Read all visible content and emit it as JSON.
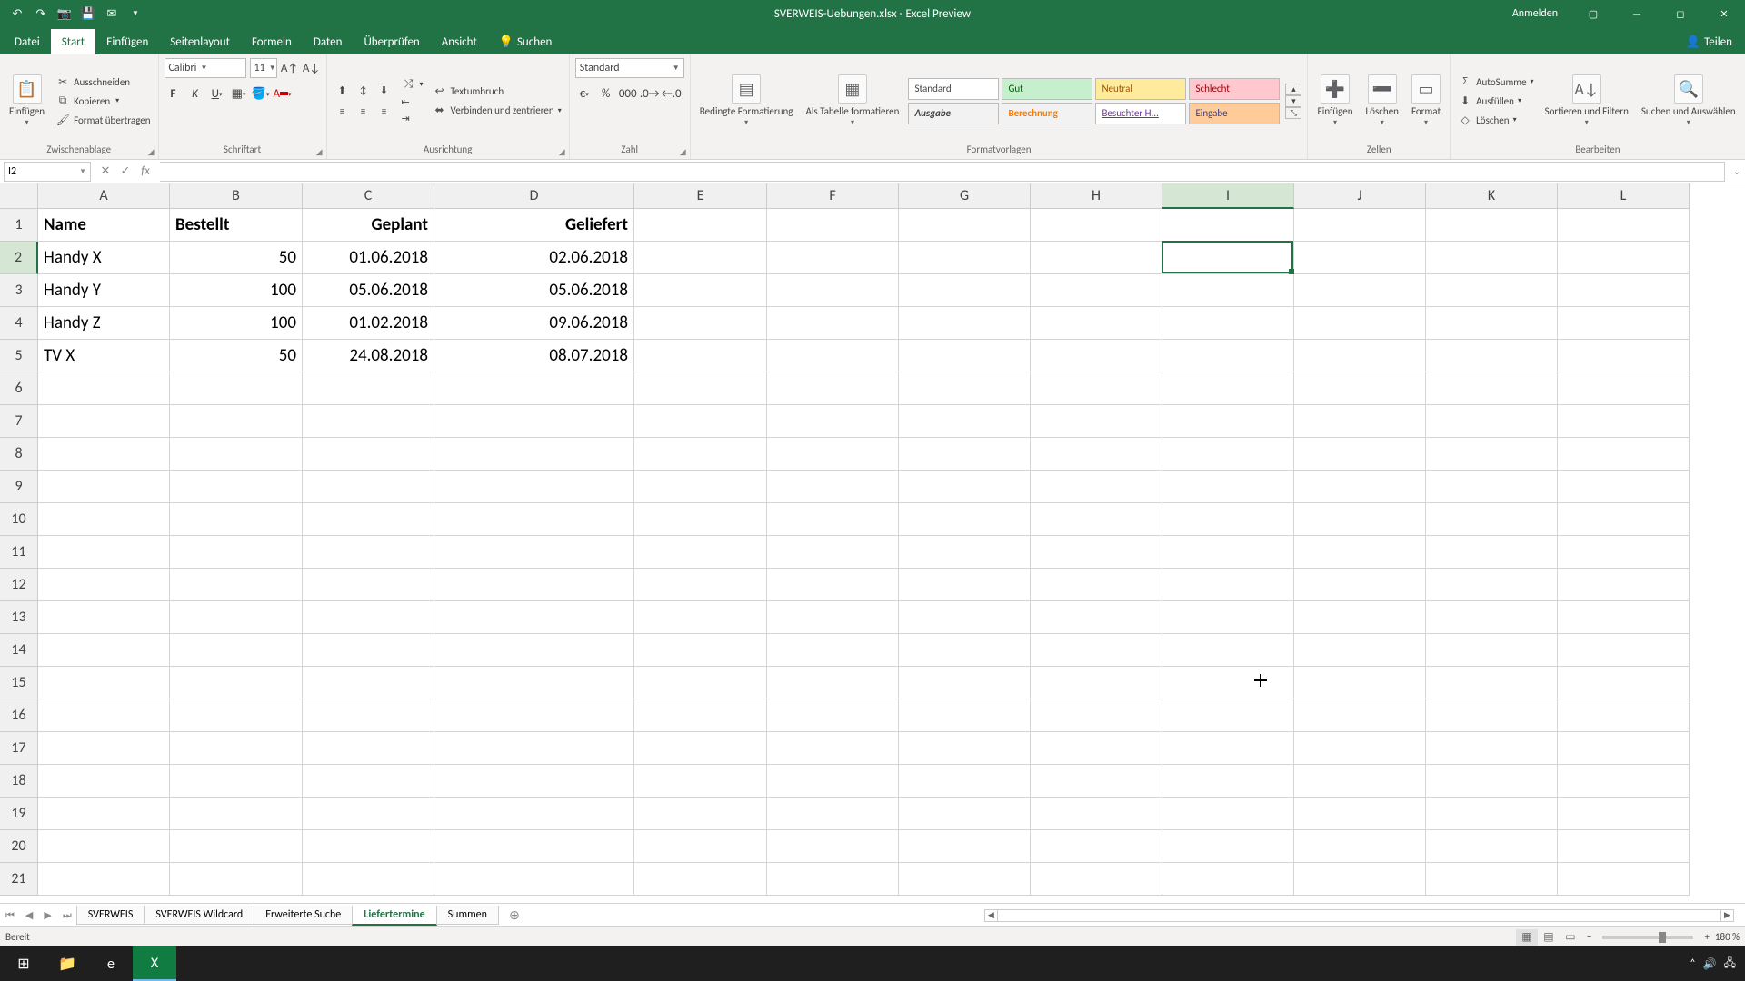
{
  "title": "SVERWEIS-Uebungen.xlsx - Excel Preview",
  "signin": "Anmelden",
  "ribbon": {
    "tabs": {
      "file": "Datei",
      "start": "Start",
      "einfuegen": "Einfügen",
      "seitenlayout": "Seitenlayout",
      "formeln": "Formeln",
      "daten": "Daten",
      "ueberpruefen": "Überprüfen",
      "ansicht": "Ansicht",
      "suchen": "Suchen",
      "teilen": "Teilen"
    },
    "clipboard": {
      "einfuegen": "Einfügen",
      "ausschneiden": "Ausschneiden",
      "kopieren": "Kopieren",
      "format": "Format übertragen",
      "label": "Zwischenablage"
    },
    "font": {
      "name": "Calibri",
      "size": "11",
      "label": "Schriftart"
    },
    "align": {
      "textumbruch": "Textumbruch",
      "verbinden": "Verbinden und zentrieren",
      "label": "Ausrichtung"
    },
    "number": {
      "format": "Standard",
      "label": "Zahl"
    },
    "styles": {
      "bedingte": "Bedingte Formatierung",
      "alstabelle": "Als Tabelle formatieren",
      "standard": "Standard",
      "gut": "Gut",
      "neutral": "Neutral",
      "schlecht": "Schlecht",
      "ausgabe": "Ausgabe",
      "berechnung": "Berechnung",
      "besuchter": "Besuchter H...",
      "eingabe": "Eingabe",
      "label": "Formatvorlagen"
    },
    "cells": {
      "einfuegen": "Einfügen",
      "loeschen": "Löschen",
      "format": "Format",
      "label": "Zellen"
    },
    "editing": {
      "autosumme": "AutoSumme",
      "ausfuellen": "Ausfüllen",
      "loeschen": "Löschen",
      "sortieren": "Sortieren und Filtern",
      "suchen": "Suchen und Auswählen",
      "label": "Bearbeiten"
    }
  },
  "namebox": "I2",
  "formula": "",
  "columns": [
    "A",
    "B",
    "C",
    "D",
    "E",
    "F",
    "G",
    "H",
    "I",
    "J",
    "K",
    "L"
  ],
  "active_col": "I",
  "active_row": 2,
  "headers": {
    "A": "Name",
    "B": "Bestellt",
    "C": "Geplant",
    "D": "Geliefert"
  },
  "rows": [
    {
      "A": "Handy X",
      "B": "50",
      "C": "01.06.2018",
      "D": "02.06.2018"
    },
    {
      "A": "Handy Y",
      "B": "100",
      "C": "05.06.2018",
      "D": "05.06.2018"
    },
    {
      "A": "Handy Z",
      "B": "100",
      "C": "01.02.2018",
      "D": "09.06.2018"
    },
    {
      "A": "TV X",
      "B": "50",
      "C": "24.08.2018",
      "D": "08.07.2018"
    }
  ],
  "sheets": {
    "s1": "SVERWEIS",
    "s2": "SVERWEIS Wildcard",
    "s3": "Erweiterte Suche",
    "s4": "Liefertermine",
    "s5": "Summen",
    "active": "s4"
  },
  "status": {
    "ready": "Bereit",
    "zoom": "180 %"
  }
}
